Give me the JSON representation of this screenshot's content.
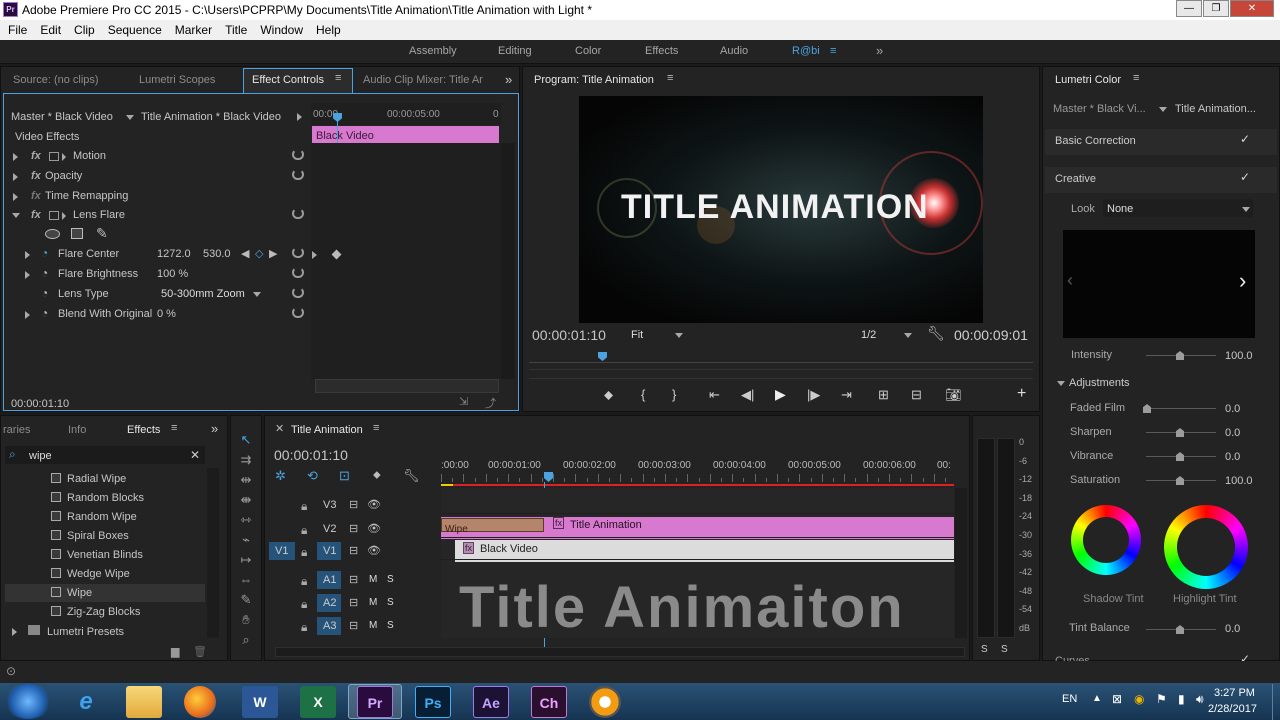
{
  "window": {
    "icon": "Pr",
    "title": "Adobe Premiere Pro CC 2015 - C:\\Users\\PCPRP\\My Documents\\Title Animation\\Title Animation with Light *",
    "min": "—",
    "max": "❐",
    "close": "✕"
  },
  "menu": [
    "File",
    "Edit",
    "Clip",
    "Sequence",
    "Marker",
    "Title",
    "Window",
    "Help"
  ],
  "workspaces": [
    "Assembly",
    "Editing",
    "Color",
    "Effects",
    "Audio",
    "R@bi"
  ],
  "ws_more": "»",
  "top_left_tabs": {
    "source": "Source: (no clips)",
    "lumetri_scopes": "Lumetri Scopes",
    "effect_controls": "Effect Controls",
    "audio_mixer": "Audio Clip Mixer: Title Ar"
  },
  "effect_controls": {
    "master": "Master * Black Video",
    "sequence": "Title Animation * Black Video",
    "ruler": [
      "00:00",
      "00:00:05:00",
      "0"
    ],
    "clip_label": "Black Video",
    "section": "Video Effects",
    "effects": [
      "Motion",
      "Opacity",
      "Time Remapping",
      "Lens Flare"
    ],
    "params": [
      {
        "name": "Flare Center",
        "value": "1272.0",
        "value2": "530.0"
      },
      {
        "name": "Flare Brightness",
        "value": "100 %"
      },
      {
        "name": "Lens Type",
        "value": "50-300mm Zoom"
      },
      {
        "name": "Blend With Original",
        "value": "0 %"
      }
    ],
    "timecode": "00:00:01:10"
  },
  "program": {
    "title": "Program: Title Animation",
    "overlay_text": "TITLE ANIMATION",
    "timecode": "00:00:01:10",
    "fit": "Fit",
    "res": "1/2",
    "duration": "00:00:09:01"
  },
  "lumetri": {
    "title": "Lumetri Color",
    "master": "Master * Black Vi...",
    "sequence": "Title Animation...",
    "basic": "Basic Correction",
    "creative": "Creative",
    "look_label": "Look",
    "look_value": "None",
    "intensity_label": "Intensity",
    "intensity": "100.0",
    "adjustments": "Adjustments",
    "sliders": [
      {
        "name": "Faded Film",
        "value": "0.0",
        "pos": 0
      },
      {
        "name": "Sharpen",
        "value": "0.0",
        "pos": 0.5
      },
      {
        "name": "Vibrance",
        "value": "0.0",
        "pos": 0.5
      },
      {
        "name": "Saturation",
        "value": "100.0",
        "pos": 0.5
      }
    ],
    "shadow": "Shadow Tint",
    "highlight": "Highlight Tint",
    "tint_balance": "Tint Balance",
    "tint_value": "0.0",
    "curves": "Curves"
  },
  "effects_panel": {
    "tabs": [
      "raries",
      "Info",
      "Effects"
    ],
    "search": "wipe",
    "items": [
      "Radial Wipe",
      "Random Blocks",
      "Random Wipe",
      "Spiral Boxes",
      "Venetian Blinds",
      "Wedge Wipe",
      "Wipe",
      "Zig-Zag Blocks"
    ],
    "presets": "Lumetri Presets"
  },
  "timeline": {
    "tab": "Title Animation",
    "timecode": "00:00:01:10",
    "ruler": [
      ":00:00",
      "00:00:01:00",
      "00:00:02:00",
      "00:00:03:00",
      "00:00:04:00",
      "00:00:05:00",
      "00:00:06:00",
      "00:"
    ],
    "video_tracks": [
      "V3",
      "V2",
      "V1"
    ],
    "audio_tracks": [
      "A1",
      "A2",
      "A3"
    ],
    "src_v": "V1",
    "mute": "M",
    "solo": "S",
    "clip_title": "Title Animation",
    "clip_transition": "Wipe",
    "clip_black": "Black Video",
    "watermark": "Title Animaiton"
  },
  "meter": {
    "scale": [
      "0",
      "-6",
      "-12",
      "-18",
      "-24",
      "-30",
      "-36",
      "-42",
      "-48",
      "-54",
      "dB"
    ],
    "solo": [
      "S",
      "S"
    ]
  },
  "taskbar": {
    "lang": "EN",
    "time": "3:27 PM",
    "date": "2/28/2017",
    "apps": [
      "e",
      "",
      "",
      "W",
      "X",
      "Pr",
      "Ps",
      "Ae",
      "Ch",
      ""
    ]
  }
}
